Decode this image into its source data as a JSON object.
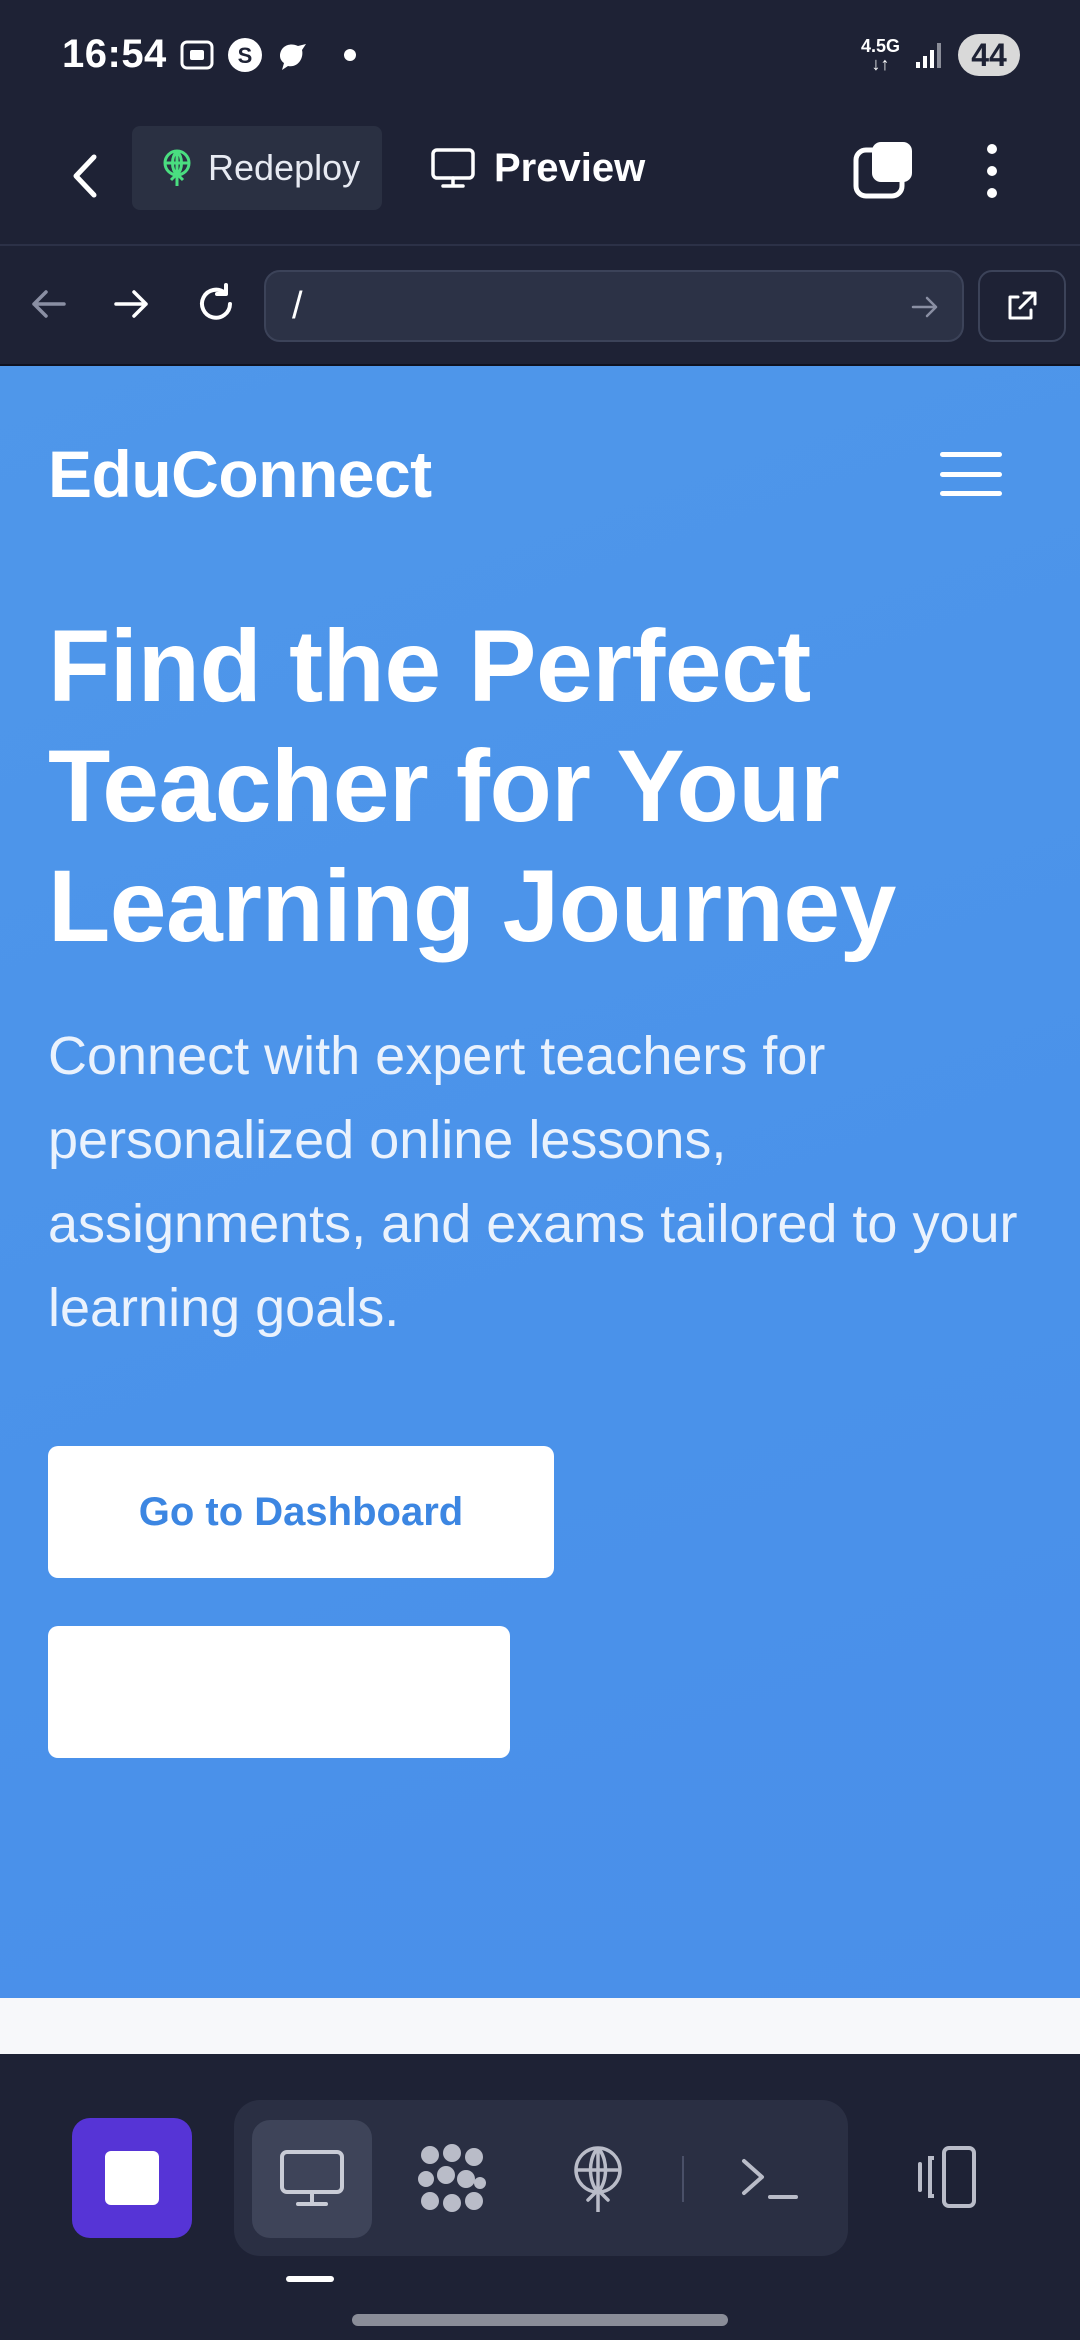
{
  "status_bar": {
    "time": "16:54",
    "network_label_top": "4.5G",
    "battery": "44",
    "left_icons": [
      "screenshot-icon",
      "s-app-icon",
      "bird-app-icon"
    ],
    "right_icons": [
      "network-icon",
      "signal-bars-icon"
    ]
  },
  "toolbar": {
    "redeploy_label": "Redeploy",
    "preview_label": "Preview"
  },
  "browser": {
    "url": "/"
  },
  "site": {
    "brand": "EduConnect",
    "hero_title": "Find the Perfect Teacher for Your Learning Journey",
    "hero_subtitle": "Connect with expert teachers for personalized online lessons, assignments, and exams tailored to your learning goals.",
    "primary_button": "Go to Dashboard",
    "secondary_button": ""
  },
  "dock": {
    "items": [
      "webview-icon",
      "apps-grid-icon",
      "deploy-icon",
      "terminal-icon"
    ],
    "active_item": "webview-icon"
  },
  "colors": {
    "chrome_bg": "#1e2235",
    "hero_bg": "#4a92ea",
    "stop_button": "#5634d6",
    "redeploy_icon": "#4ade80",
    "primary_button_text": "#3c86e2"
  }
}
